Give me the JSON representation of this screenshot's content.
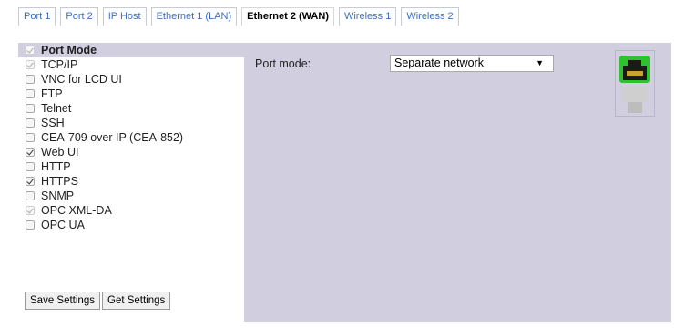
{
  "tabs": [
    {
      "label": "Port 1",
      "active": false
    },
    {
      "label": "Port 2",
      "active": false
    },
    {
      "label": "IP Host",
      "active": false
    },
    {
      "label": "Ethernet 1 (LAN)",
      "active": false
    },
    {
      "label": "Ethernet 2 (WAN)",
      "active": true
    },
    {
      "label": "Wireless 1",
      "active": false
    },
    {
      "label": "Wireless 2",
      "active": false
    }
  ],
  "services": [
    {
      "label": "Port Mode",
      "checked": true,
      "disabled": true,
      "header": true
    },
    {
      "label": "TCP/IP",
      "checked": true,
      "disabled": true
    },
    {
      "label": "VNC for LCD UI",
      "checked": false,
      "disabled": false
    },
    {
      "label": "FTP",
      "checked": false,
      "disabled": false
    },
    {
      "label": "Telnet",
      "checked": false,
      "disabled": false
    },
    {
      "label": "SSH",
      "checked": false,
      "disabled": false
    },
    {
      "label": "CEA-709 over IP (CEA-852)",
      "checked": false,
      "disabled": false
    },
    {
      "label": "Web UI",
      "checked": true,
      "disabled": false
    },
    {
      "label": "HTTP",
      "checked": false,
      "disabled": false
    },
    {
      "label": "HTTPS",
      "checked": true,
      "disabled": false
    },
    {
      "label": "SNMP",
      "checked": false,
      "disabled": false
    },
    {
      "label": "OPC XML-DA",
      "checked": true,
      "disabled": true
    },
    {
      "label": "OPC UA",
      "checked": false,
      "disabled": false
    }
  ],
  "buttons": {
    "save": "Save Settings",
    "get": "Get Settings"
  },
  "port_mode": {
    "label": "Port mode:",
    "value": "Separate network",
    "arrow": "▼"
  },
  "colors": {
    "panel_bg": "#d1cfdf",
    "tab_link": "#3a6fc0",
    "port_active": "#2fc12f",
    "port_inactive": "#cfcfcf"
  },
  "icons": {
    "port_status": "ethernet-port-icon"
  }
}
